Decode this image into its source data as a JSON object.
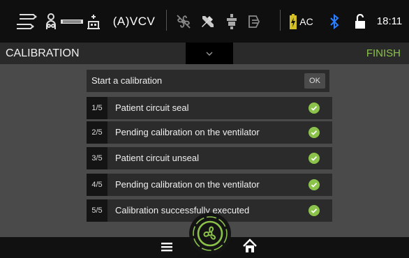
{
  "status_bar": {
    "mode": "(A)VCV",
    "battery_label": "AC",
    "time": "18:11",
    "icons": [
      "patient-circuit-icon",
      "infant-scale-icon",
      "fan-off-icon",
      "tools-icon",
      "nebulizer-icon",
      "mask-icon",
      "battery-charging-icon",
      "bluetooth-icon",
      "unlocked-lock-icon"
    ]
  },
  "title_bar": {
    "title": "CALIBRATION",
    "finish_label": "FINISH"
  },
  "calibration": {
    "header": "Start a calibration",
    "ok_label": "OK",
    "steps": [
      {
        "num": "1/5",
        "label": "Patient circuit seal"
      },
      {
        "num": "2/5",
        "label": "Pending calibration on the ventilator"
      },
      {
        "num": "3/5",
        "label": "Patient circuit unseal"
      },
      {
        "num": "4/5",
        "label": "Pending calibration on the ventilator"
      },
      {
        "num": "5/5",
        "label": "Calibration successfully executed"
      }
    ]
  },
  "bottom_bar": {
    "icons": [
      "menu-icon",
      "fan-icon",
      "home-icon"
    ]
  },
  "colors": {
    "accent_green": "#8bc34a",
    "background": "#4a4a4a",
    "status_bar": "#0f0f0f",
    "panel": "#2b2b2b",
    "bluetooth": "#2a7fff"
  }
}
